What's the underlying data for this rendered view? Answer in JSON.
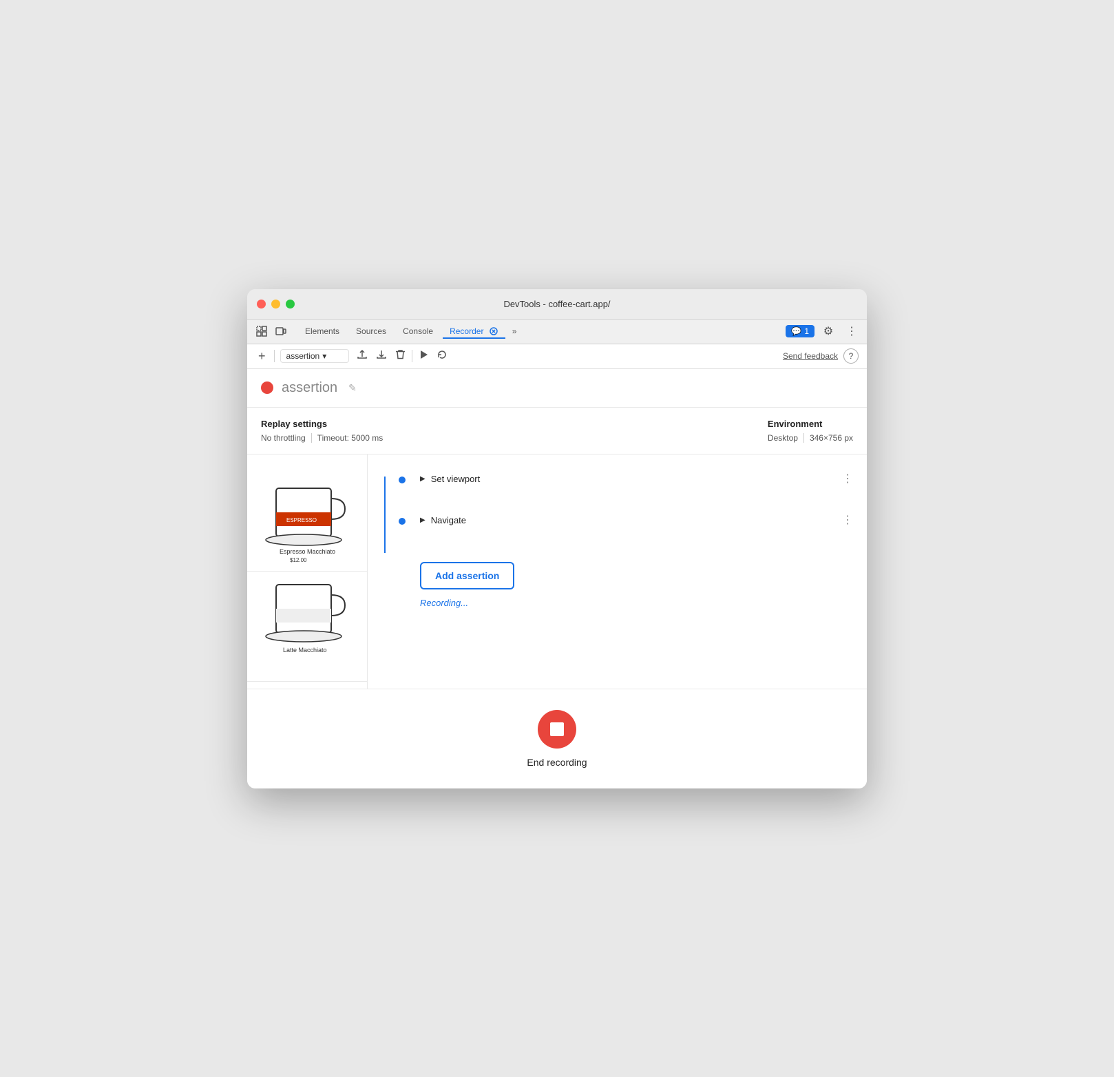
{
  "window": {
    "title": "DevTools - coffee-cart.app/"
  },
  "tabs": {
    "items": [
      {
        "label": "Elements",
        "active": false
      },
      {
        "label": "Sources",
        "active": false
      },
      {
        "label": "Console",
        "active": false
      },
      {
        "label": "Recorder",
        "active": true
      },
      {
        "label": "×",
        "active": false
      }
    ],
    "more_label": "»",
    "badge": "1",
    "settings_icon": "⚙",
    "more_icon": "⋮"
  },
  "toolbar": {
    "add_label": "+",
    "recording_name": "assertion",
    "dropdown_icon": "▾",
    "export_icon": "↑",
    "import_icon": "↓",
    "delete_icon": "🗑",
    "play_icon": "▶",
    "replay_icon": "↺",
    "send_feedback": "Send feedback",
    "help_icon": "?"
  },
  "recording": {
    "title": "assertion",
    "dot_color": "#e8453c"
  },
  "settings": {
    "replay_label": "Replay settings",
    "throttling": "No throttling",
    "timeout": "Timeout: 5000 ms",
    "environment_label": "Environment",
    "desktop": "Desktop",
    "resolution": "346×756 px"
  },
  "steps": [
    {
      "label": "Set viewport",
      "type": "expandable"
    },
    {
      "label": "Navigate",
      "type": "expandable"
    }
  ],
  "buttons": {
    "add_assertion": "Add assertion",
    "end_recording": "End recording"
  },
  "status": {
    "recording": "Recording..."
  }
}
